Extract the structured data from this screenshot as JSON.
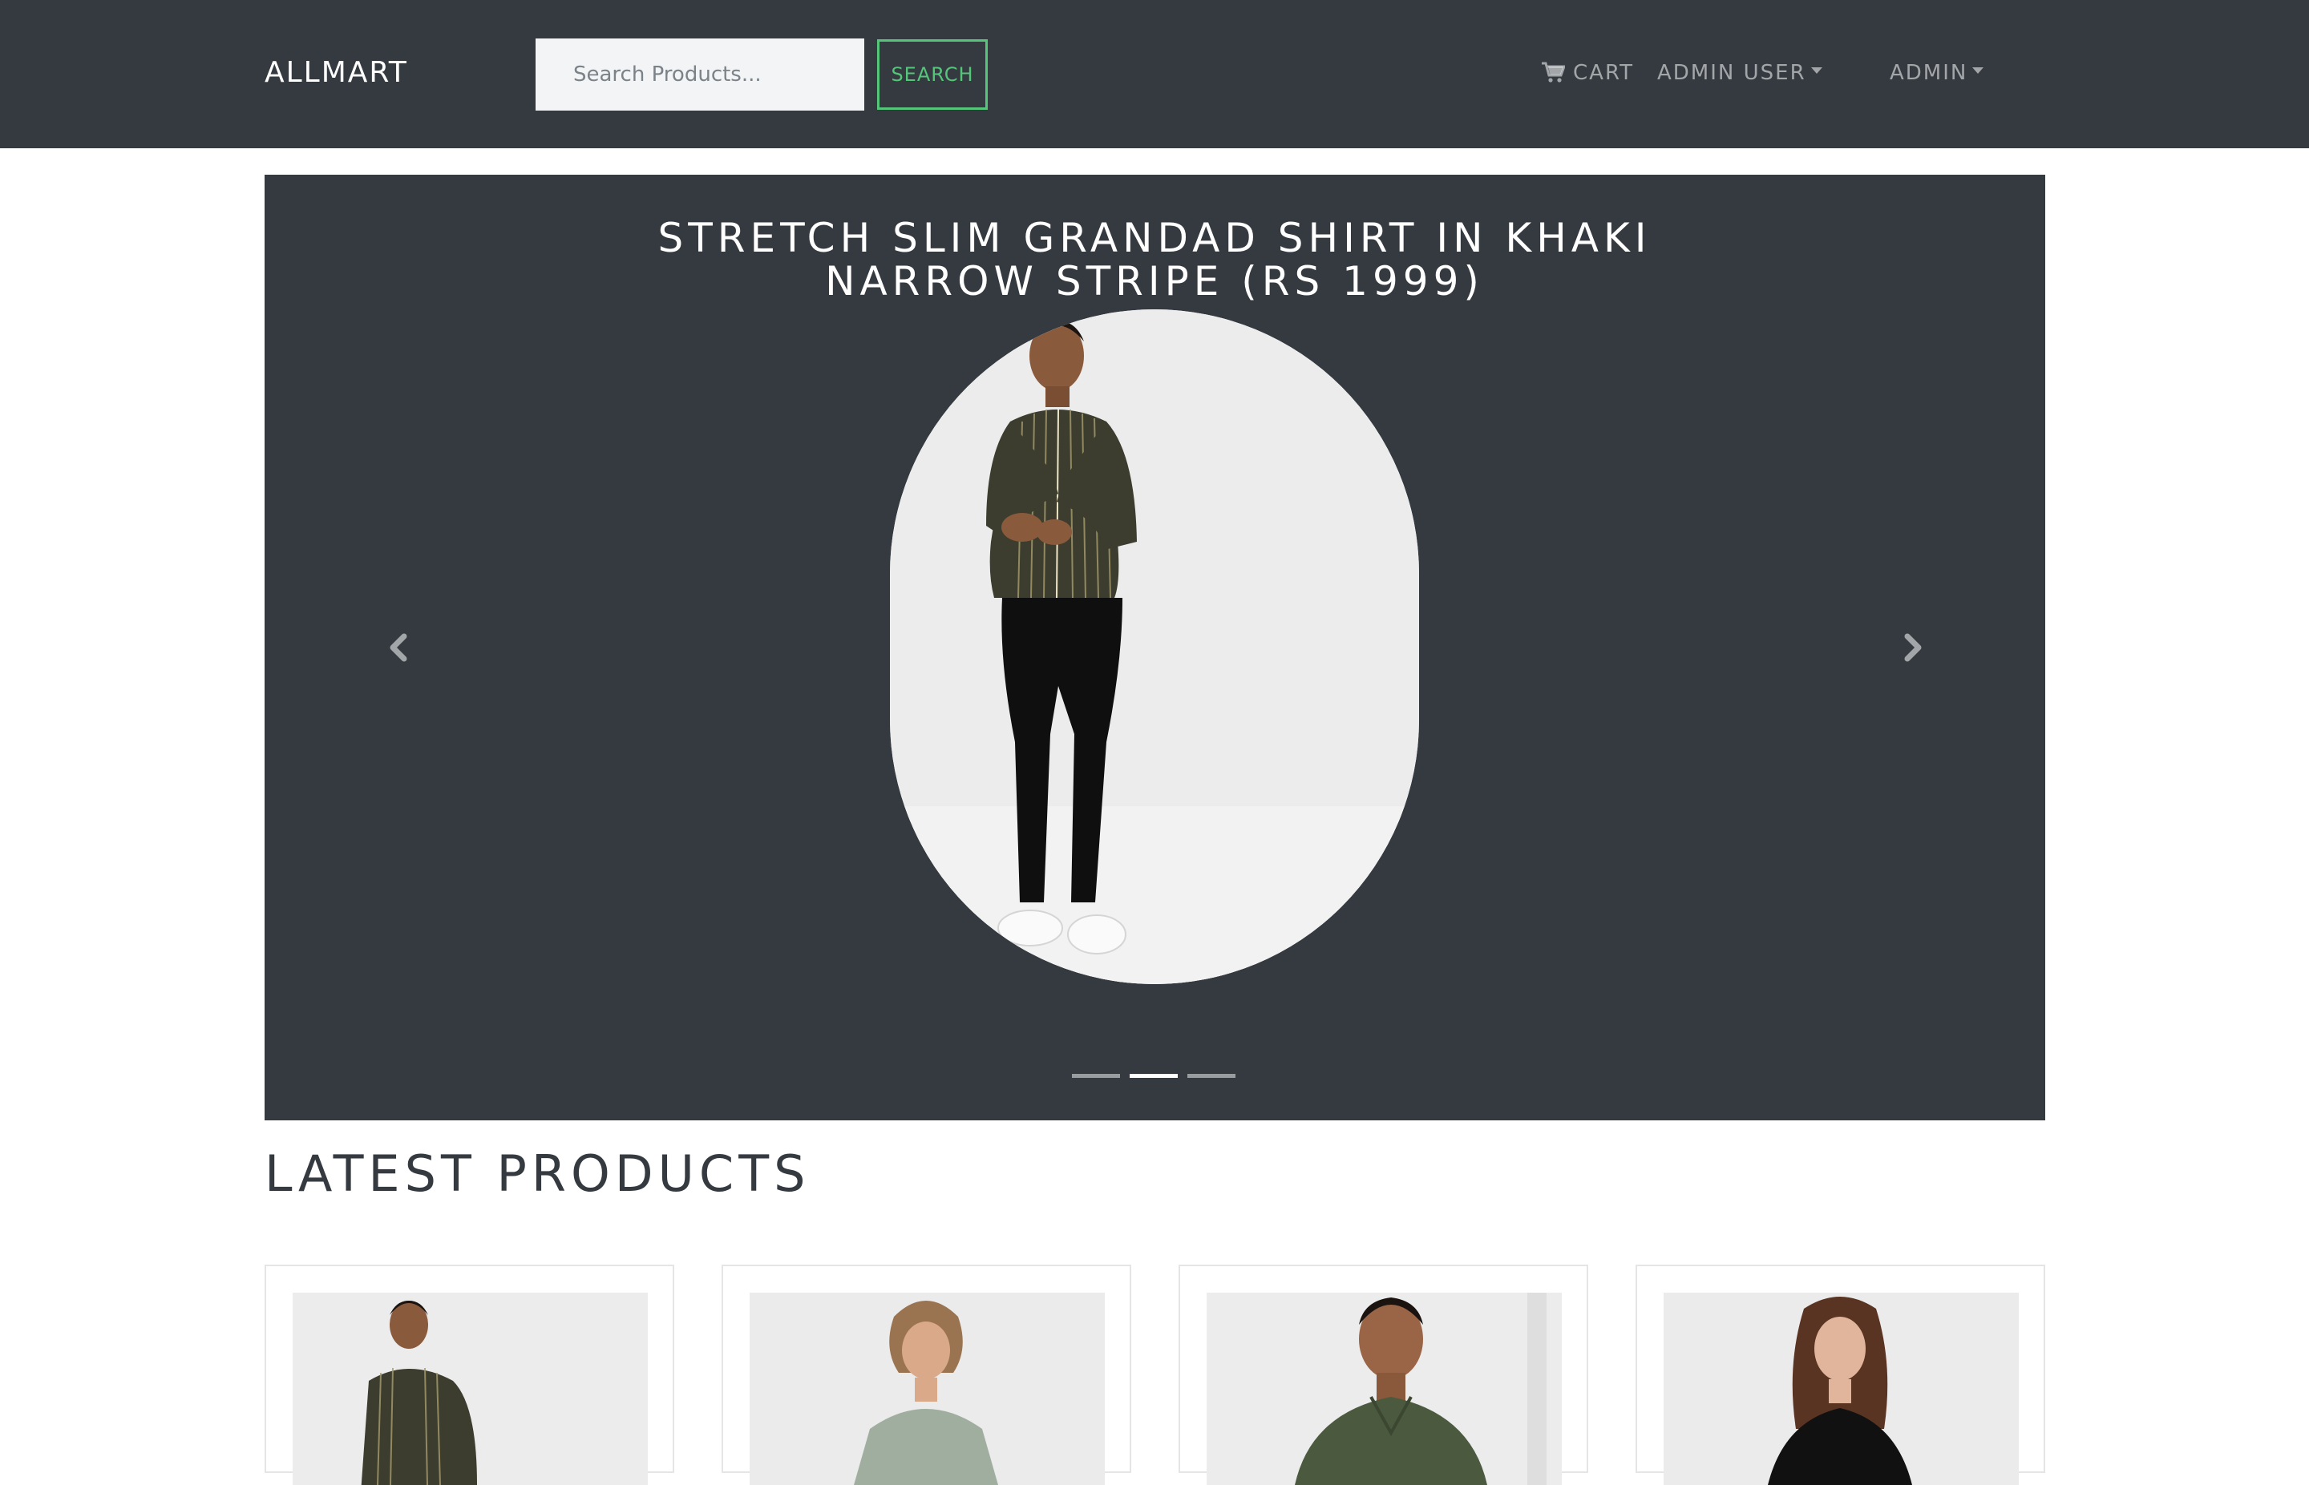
{
  "navbar": {
    "brand": "ALLMART",
    "search_placeholder": "Search Products...",
    "search_label": "SEARCH",
    "cart_label": "CART",
    "cart_icon": "shopping-cart-icon",
    "user_menu_label": "ADMIN USER",
    "admin_menu_label": "ADMIN"
  },
  "carousel": {
    "title": "STRETCH SLIM GRANDAD SHIRT IN KHAKI NARROW STRIPE (RS 1999)",
    "prev_icon": "chevron-left-icon",
    "next_icon": "chevron-right-icon",
    "slide_count": 3,
    "active_slide": 2
  },
  "latest": {
    "title": "LATEST PRODUCTS",
    "products": [
      {
        "image": "man in khaki striped shirt"
      },
      {
        "image": "woman in sage green shirt"
      },
      {
        "image": "man in olive green shirt"
      },
      {
        "image": "woman in black t-shirt"
      }
    ]
  },
  "colors": {
    "navbar_bg": "#343a40",
    "accent_green": "#55c57a",
    "carousel_bg": "#343a40"
  }
}
